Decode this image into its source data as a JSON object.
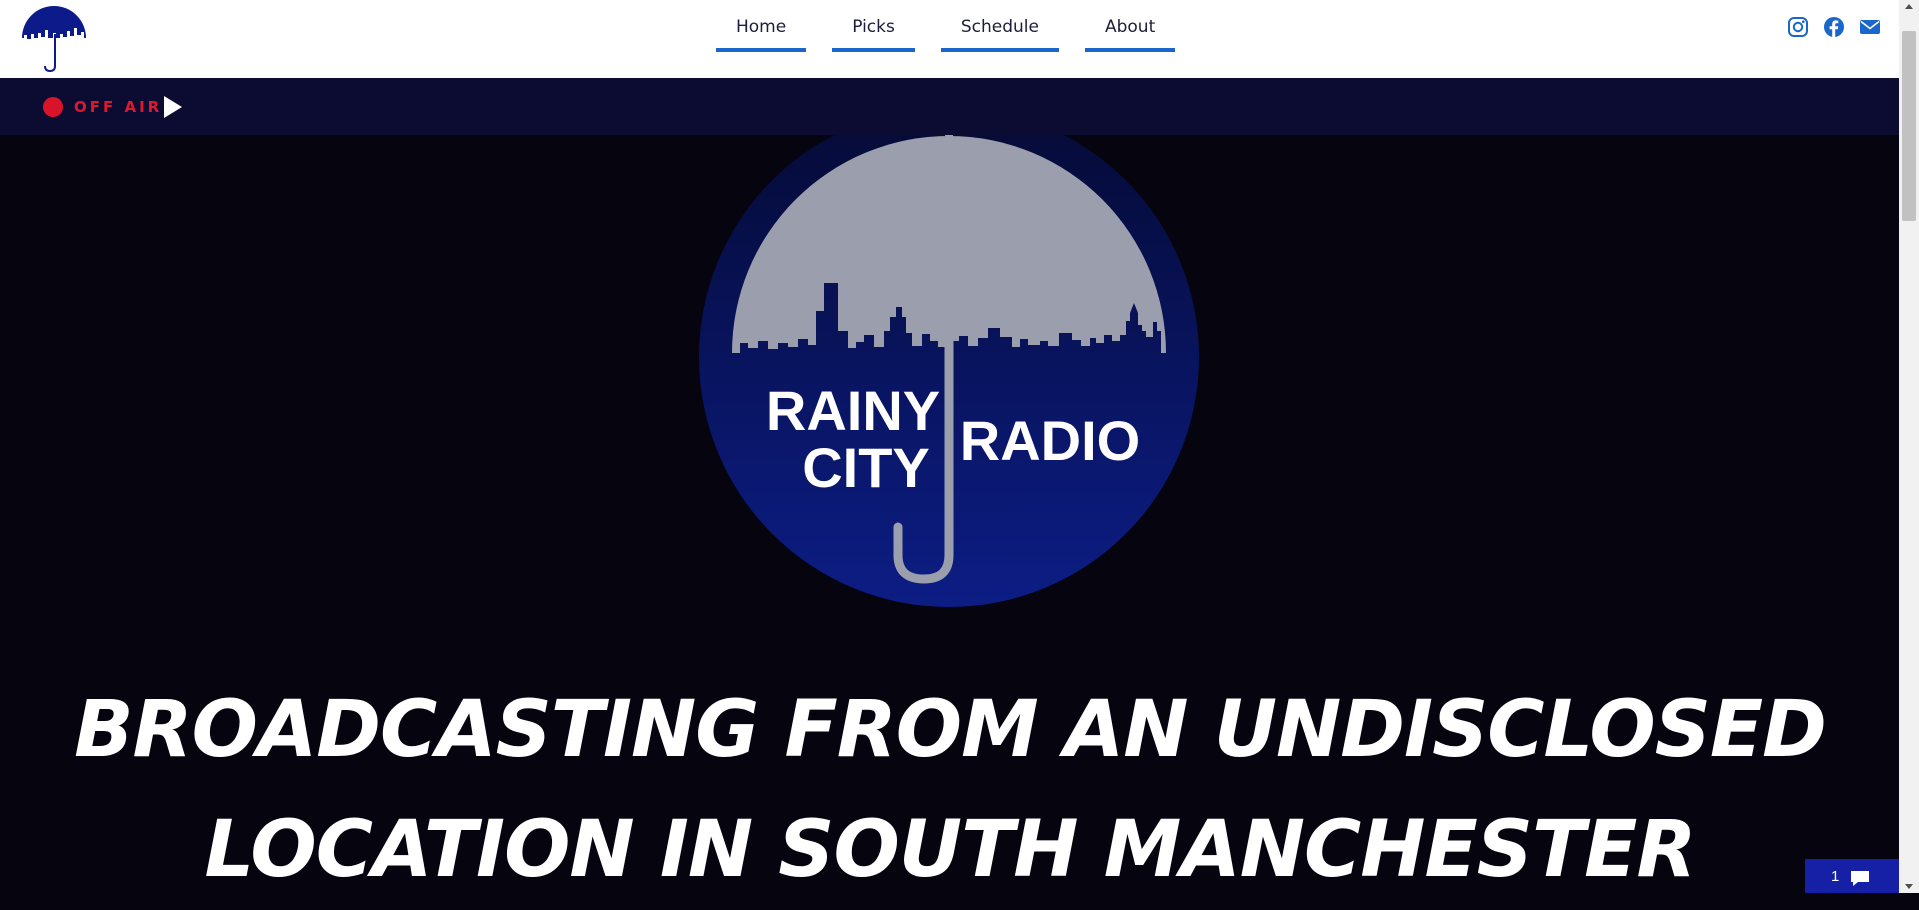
{
  "site": {
    "logo_icon": "umbrella-skyline-icon",
    "brand_color": "#0c1a8a"
  },
  "nav": {
    "items": [
      {
        "label": "Home"
      },
      {
        "label": "Picks"
      },
      {
        "label": "Schedule"
      },
      {
        "label": "About"
      }
    ],
    "underline_color": "#1a66cc"
  },
  "social": {
    "icons": [
      "instagram-icon",
      "facebook-icon",
      "email-icon"
    ],
    "color": "#1a66cc"
  },
  "player": {
    "status": "OFF AIR",
    "status_color": "#e0182d",
    "play_icon": "play-icon"
  },
  "emblem": {
    "line1": "RAINY",
    "line2": "CITY",
    "line3": "RADIO"
  },
  "hero": {
    "headline": "Broadcasting from an undisclosed location in South Manchester"
  },
  "chat": {
    "count": "1",
    "icon": "chat-bubble-icon"
  }
}
